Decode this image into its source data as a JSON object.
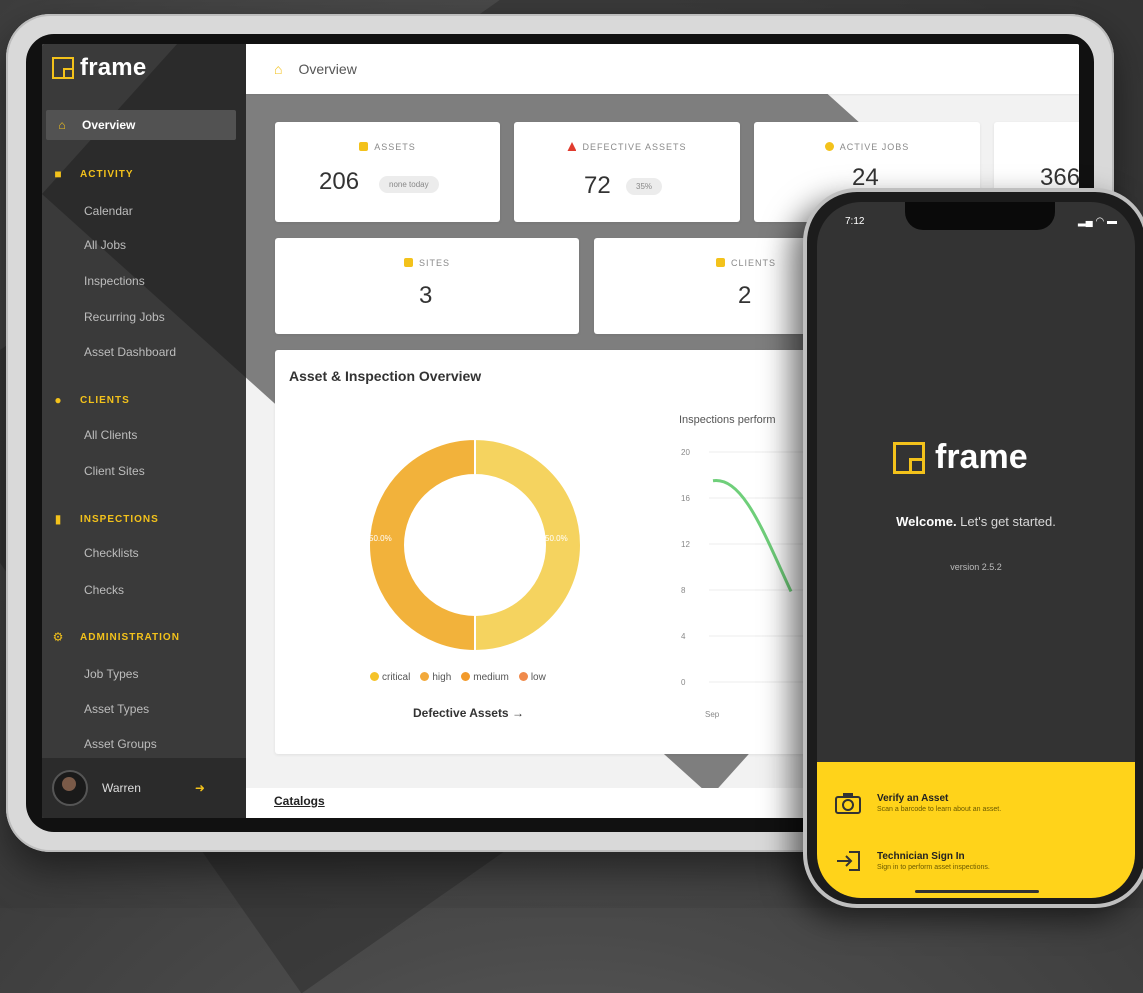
{
  "app": {
    "name": "frame"
  },
  "sidebar": {
    "overview": "Overview",
    "sections": [
      {
        "label": "ACTIVITY",
        "items": [
          "Calendar",
          "All Jobs",
          "Inspections",
          "Recurring Jobs",
          "Asset Dashboard"
        ]
      },
      {
        "label": "CLIENTS",
        "items": [
          "All Clients",
          "Client Sites"
        ]
      },
      {
        "label": "INSPECTIONS",
        "items": [
          "Checklists",
          "Checks"
        ]
      },
      {
        "label": "ADMINISTRATION",
        "items": [
          "Job Types",
          "Asset Types",
          "Asset Groups"
        ]
      }
    ],
    "user": {
      "name": "Warren"
    }
  },
  "topbar": {
    "title": "Overview"
  },
  "stats": {
    "assets": {
      "label": "ASSETS",
      "value": "206",
      "badge": "none today"
    },
    "defective": {
      "label": "DEFECTIVE ASSETS",
      "value": "72",
      "badge": "35%"
    },
    "active_jobs": {
      "label": "ACTIVE JOBS",
      "value": "24"
    },
    "fourth": {
      "value": "366"
    },
    "sites": {
      "label": "SITES",
      "value": "3"
    },
    "clients": {
      "label": "CLIENTS",
      "value": "2"
    }
  },
  "overview": {
    "title": "Asset & Inspection Overview",
    "donut_left_label": "50.0%",
    "donut_right_label": "50.0%",
    "legend": [
      "critical",
      "high",
      "medium",
      "low"
    ],
    "link": "Defective Assets →",
    "line_title": "Inspections perform",
    "x_first": "Sep"
  },
  "catalogs": "Catalogs",
  "chart_data": [
    {
      "type": "pie",
      "title": "",
      "categories": [
        "critical",
        "high",
        "medium",
        "low"
      ],
      "values": [
        50,
        50,
        0,
        0
      ],
      "colors": [
        "#f5d35f",
        "#f2b23b",
        "#f29a2b",
        "#f08a4b"
      ]
    },
    {
      "type": "line",
      "title": "Inspections perform",
      "x": [
        "Sep"
      ],
      "series": [
        {
          "values": [
            17.5
          ]
        }
      ],
      "yticks": [
        0,
        4,
        8,
        12,
        16,
        20
      ],
      "ylim": [
        0,
        20
      ]
    }
  ],
  "phone": {
    "time": "7:12",
    "brand": "frame",
    "welcome_bold": "Welcome.",
    "welcome_rest": " Let's get started.",
    "version": "version 2.5.2",
    "actions": [
      {
        "title": "Verify an Asset",
        "desc": "Scan a barcode to learn about an asset."
      },
      {
        "title": "Technician Sign In",
        "desc": "Sign in to perform asset inspections."
      }
    ]
  }
}
